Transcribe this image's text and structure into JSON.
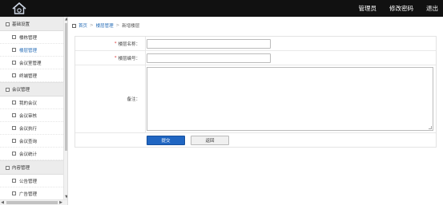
{
  "topbar": {
    "nav": [
      "管理员",
      "修改密码",
      "退出"
    ]
  },
  "sidebar": {
    "groups": [
      {
        "label": "基础设置",
        "items": [
          {
            "label": "楼栋管理",
            "active": false
          },
          {
            "label": "楼层管理",
            "active": true
          },
          {
            "label": "会议室管理",
            "active": false
          },
          {
            "label": "终端管理",
            "active": false
          }
        ]
      },
      {
        "label": "会议管理",
        "items": [
          {
            "label": "我的会议",
            "active": false
          },
          {
            "label": "会议审核",
            "active": false
          },
          {
            "label": "会议执行",
            "active": false
          },
          {
            "label": "会议查询",
            "active": false
          },
          {
            "label": "会议统计",
            "active": false
          }
        ]
      },
      {
        "label": "内容管理",
        "items": [
          {
            "label": "公告管理",
            "active": false
          },
          {
            "label": "广告管理",
            "active": false
          }
        ]
      }
    ]
  },
  "breadcrumb": {
    "home": "首页",
    "parent": "楼层管理",
    "current": "新增楼层",
    "separator": ">"
  },
  "form": {
    "name_label": "楼层名称：",
    "code_label": "楼层编号：",
    "remark_label": "备注：",
    "required_mark": "*",
    "name_value": "",
    "code_value": "",
    "remark_value": "",
    "submit_label": "提交",
    "back_label": "返回"
  },
  "colors": {
    "topbar": "#111111",
    "link": "#2a6fb8",
    "primary_button": "#2066c2",
    "required": "#dd3333"
  }
}
